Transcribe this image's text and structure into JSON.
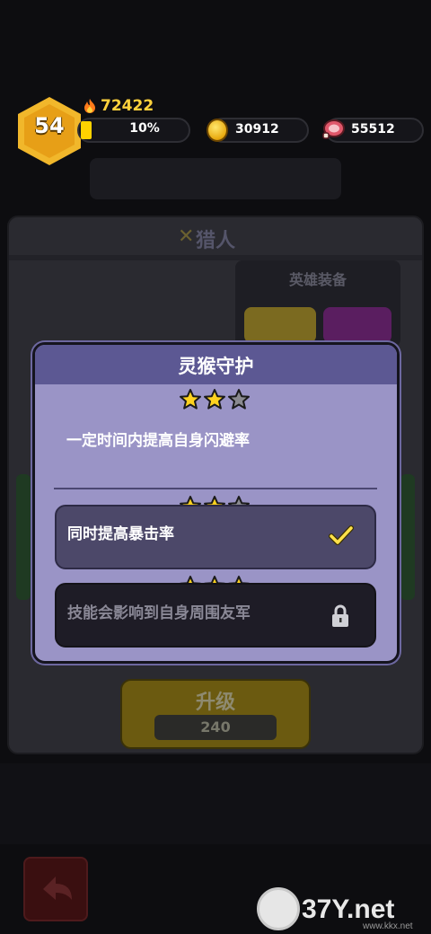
{
  "hud": {
    "level": "54",
    "power": "72422",
    "xp_percent_label": "10%",
    "xp_fraction": 0.1,
    "gold": "30912",
    "meat": "55512"
  },
  "background": {
    "hero_name": "猎人",
    "equip_label": "英雄装备",
    "upgrade_label": "升级",
    "upgrade_cost": "240"
  },
  "modal": {
    "title": "灵猴守护",
    "skill_stars_filled": 2,
    "skill_stars_total": 3,
    "description": "一定时间内提高自身闪避率",
    "options": [
      {
        "text": "同时提高暴击率",
        "stars_filled": 2,
        "status": "unlocked"
      },
      {
        "text": "技能会影响到自身周围友军",
        "stars_filled": 3,
        "status": "locked"
      }
    ]
  },
  "watermark": {
    "brand": "37Y.net",
    "sub": "www.kkx.net"
  },
  "colors": {
    "star_gold": "#ffd21f",
    "star_grey": "#8a8a90",
    "modal_bg": "#9a94c6",
    "modal_header": "#5c5893",
    "accent_yellow": "#ffd200"
  }
}
